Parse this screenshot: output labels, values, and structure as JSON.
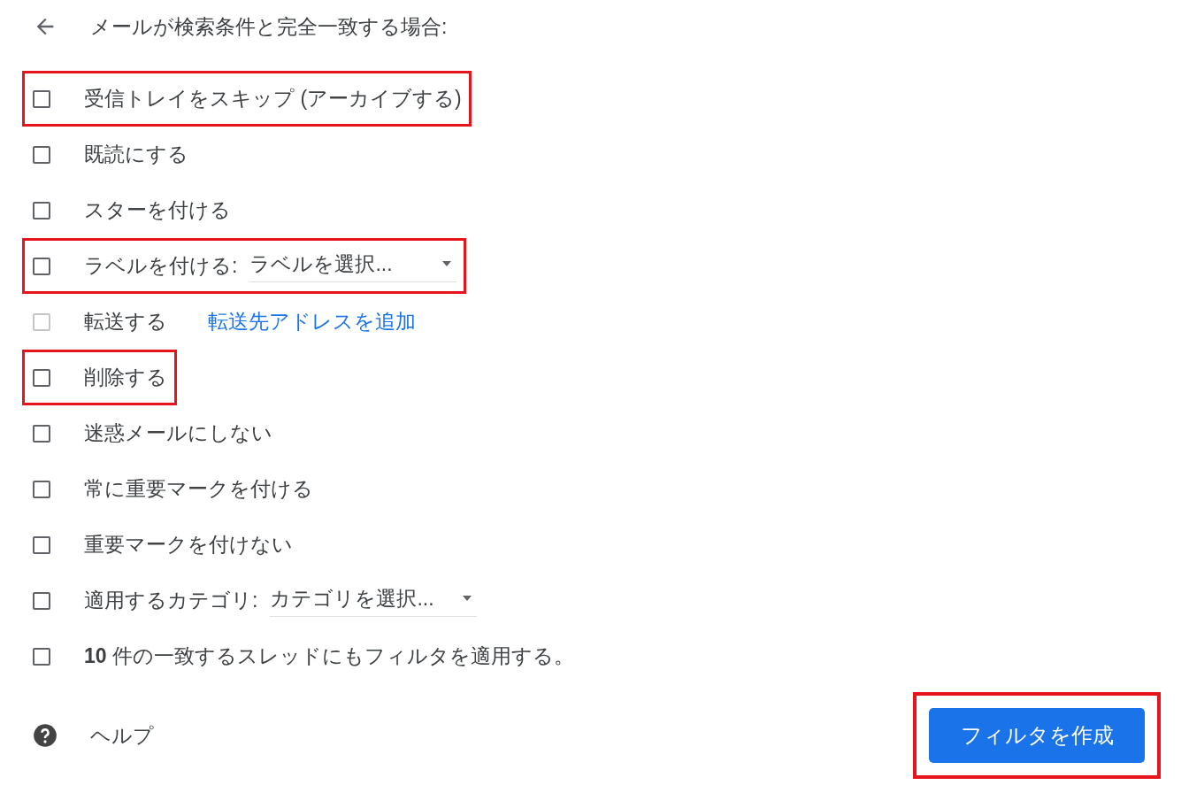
{
  "header": {
    "title": "メールが検索条件と完全一致する場合:"
  },
  "actions": [
    {
      "kind": "plain",
      "label": "受信トレイをスキップ (アーカイブする)",
      "checked": false,
      "disabled": false,
      "highlighted": true
    },
    {
      "kind": "plain",
      "label": "既読にする",
      "checked": false,
      "disabled": false,
      "highlighted": false
    },
    {
      "kind": "plain",
      "label": "スターを付ける",
      "checked": false,
      "disabled": false,
      "highlighted": false
    },
    {
      "kind": "select",
      "label": "ラベルを付ける:",
      "placeholder": "ラベルを選択...",
      "checked": false,
      "disabled": false,
      "highlighted": true
    },
    {
      "kind": "link",
      "label": "転送する",
      "link": "転送先アドレスを追加",
      "checked": false,
      "disabled": true,
      "highlighted": false
    },
    {
      "kind": "plain",
      "label": "削除する",
      "checked": false,
      "disabled": false,
      "highlighted": true
    },
    {
      "kind": "plain",
      "label": "迷惑メールにしない",
      "checked": false,
      "disabled": false,
      "highlighted": false
    },
    {
      "kind": "plain",
      "label": "常に重要マークを付ける",
      "checked": false,
      "disabled": false,
      "highlighted": false
    },
    {
      "kind": "plain",
      "label": "重要マークを付けない",
      "checked": false,
      "disabled": false,
      "highlighted": false
    },
    {
      "kind": "select",
      "label": "適用するカテゴリ:",
      "placeholder": "カテゴリを選択...",
      "checked": false,
      "disabled": false,
      "highlighted": false
    },
    {
      "kind": "plain",
      "label": "**10** 件の一致するスレッドにもフィルタを適用する。",
      "checked": false,
      "disabled": false,
      "highlighted": false
    }
  ],
  "footer": {
    "help": "ヘルプ",
    "create_button": {
      "label": "フィルタを作成",
      "highlighted": true
    }
  }
}
